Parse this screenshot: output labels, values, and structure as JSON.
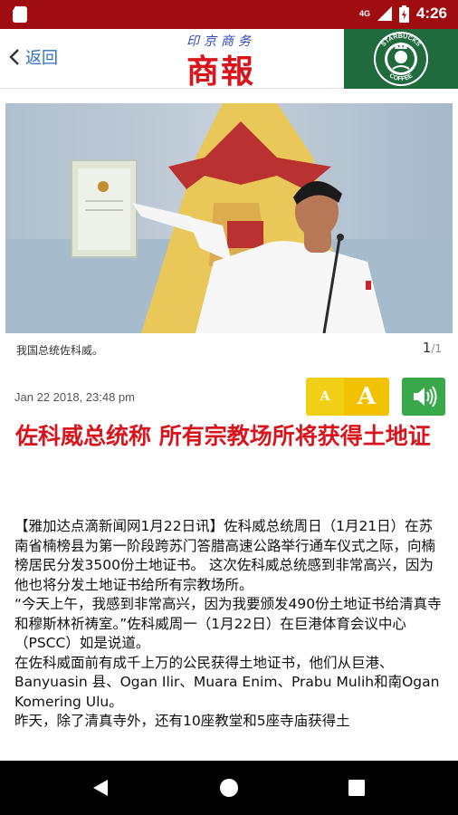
{
  "status_bar": {
    "network": "4G",
    "time": "4:26"
  },
  "header": {
    "back_label": "返回",
    "logo_small": "印京商务",
    "logo_big": "商報",
    "ad_text_top": "STARBUCKS",
    "ad_text_bottom": "COFFEE"
  },
  "photo": {
    "caption": "我国总统佐科威。",
    "page_current": "1",
    "page_total": "/1"
  },
  "article": {
    "date": "Jan 22 2018, 23:48 pm",
    "font_small_label": "A",
    "font_large_label": "A",
    "title": "佐科威总统称 所有宗教场所将获得土地证",
    "paragraphs": [
      "【雅加达点滴新闻网1月22日讯】佐科威总统周日（1月21日）在苏南省楠榜县为第一阶段跨苏门答腊高速公路举行通车仪式之际，向楠榜居民分发3500份土地证书。 这次佐科威总统感到非常高兴，因为他也将分发土地证书给所有宗教场所。",
      "“今天上午，我感到非常高兴，因为我要颁发490份土地证书给清真寺和穆斯林祈祷室。”佐科威周一（1月22日）在巨港体育会议中心（PSCC）如是说道。",
      "在佐科威面前有成千上万的公民获得土地证书，他们从巨港、Banyuasin 县、Ogan Ilir、Muara Enim、Prabu Mulih和南Ogan Komering Ulu。",
      "昨天，除了清真寺外，还有10座教堂和5座寺庙获得土"
    ]
  }
}
